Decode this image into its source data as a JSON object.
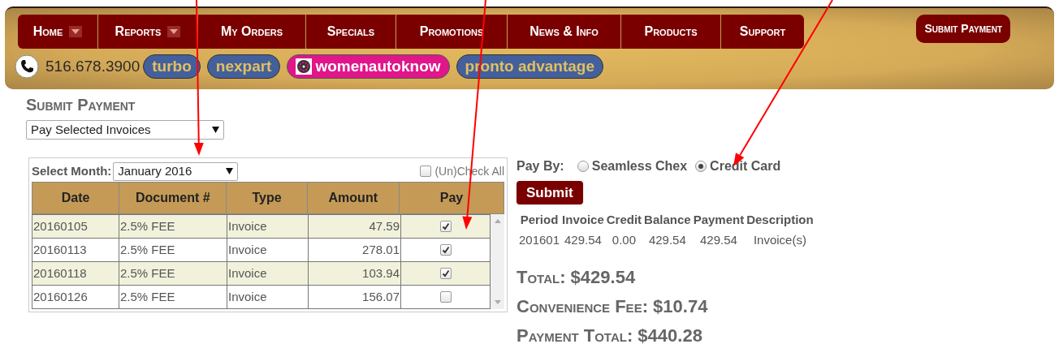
{
  "nav": {
    "items": [
      {
        "label": "Home",
        "has_dropdown": true
      },
      {
        "label": "Reports",
        "has_dropdown": true
      },
      {
        "label": "My Orders",
        "has_dropdown": false
      },
      {
        "label": "Specials",
        "has_dropdown": false
      },
      {
        "label": "Promotions",
        "has_dropdown": false
      },
      {
        "label": "News & Info",
        "has_dropdown": false
      },
      {
        "label": "Products",
        "has_dropdown": false
      },
      {
        "label": "Support",
        "has_dropdown": false
      }
    ],
    "action_button": "Submit Payment",
    "phone": "516.678.3900",
    "links": [
      {
        "label": "turbo",
        "kind": "plain"
      },
      {
        "label": "nexpart",
        "kind": "plain"
      },
      {
        "label": "womenautoknow",
        "kind": "featured"
      },
      {
        "label": "pronto advantage",
        "kind": "plain"
      }
    ]
  },
  "page": {
    "title": "Submit Payment",
    "mode_select": "Pay Selected Invoices"
  },
  "invoices": {
    "month_label": "Select Month:",
    "month": "January 2016",
    "check_all": {
      "label": "(Un)Check All",
      "checked": false
    },
    "columns": [
      "Date",
      "Document #",
      "Type",
      "Amount",
      "Pay"
    ],
    "rows": [
      {
        "date": "20160105",
        "document": "2.5% FEE",
        "type": "Invoice",
        "amount": "47.59",
        "pay": true
      },
      {
        "date": "20160113",
        "document": "2.5% FEE",
        "type": "Invoice",
        "amount": "278.01",
        "pay": true
      },
      {
        "date": "20160118",
        "document": "2.5% FEE",
        "type": "Invoice",
        "amount": "103.94",
        "pay": true
      },
      {
        "date": "20160126",
        "document": "2.5% FEE",
        "type": "Invoice",
        "amount": "156.07",
        "pay": false
      }
    ]
  },
  "payment": {
    "pay_by_label": "Pay By:",
    "methods": [
      {
        "label": "Seamless Chex",
        "selected": false
      },
      {
        "label": "Credit Card",
        "selected": true
      }
    ],
    "submit": "Submit",
    "summary": {
      "columns": [
        "Period",
        "Invoice",
        "Credit",
        "Balance",
        "Payment",
        "Description"
      ],
      "row": [
        "201601",
        "429.54",
        "0.00",
        "429.54",
        "429.54",
        "Invoice(s)"
      ]
    },
    "totals": [
      {
        "label": "Total:",
        "value": "$429.54"
      },
      {
        "label": "Convenience Fee:",
        "value": "$10.74"
      },
      {
        "label": "Payment Total:",
        "value": "$440.28"
      }
    ]
  },
  "annotations": [
    {
      "kind": "arrow"
    },
    {
      "kind": "arrow"
    },
    {
      "kind": "arrow"
    }
  ]
}
